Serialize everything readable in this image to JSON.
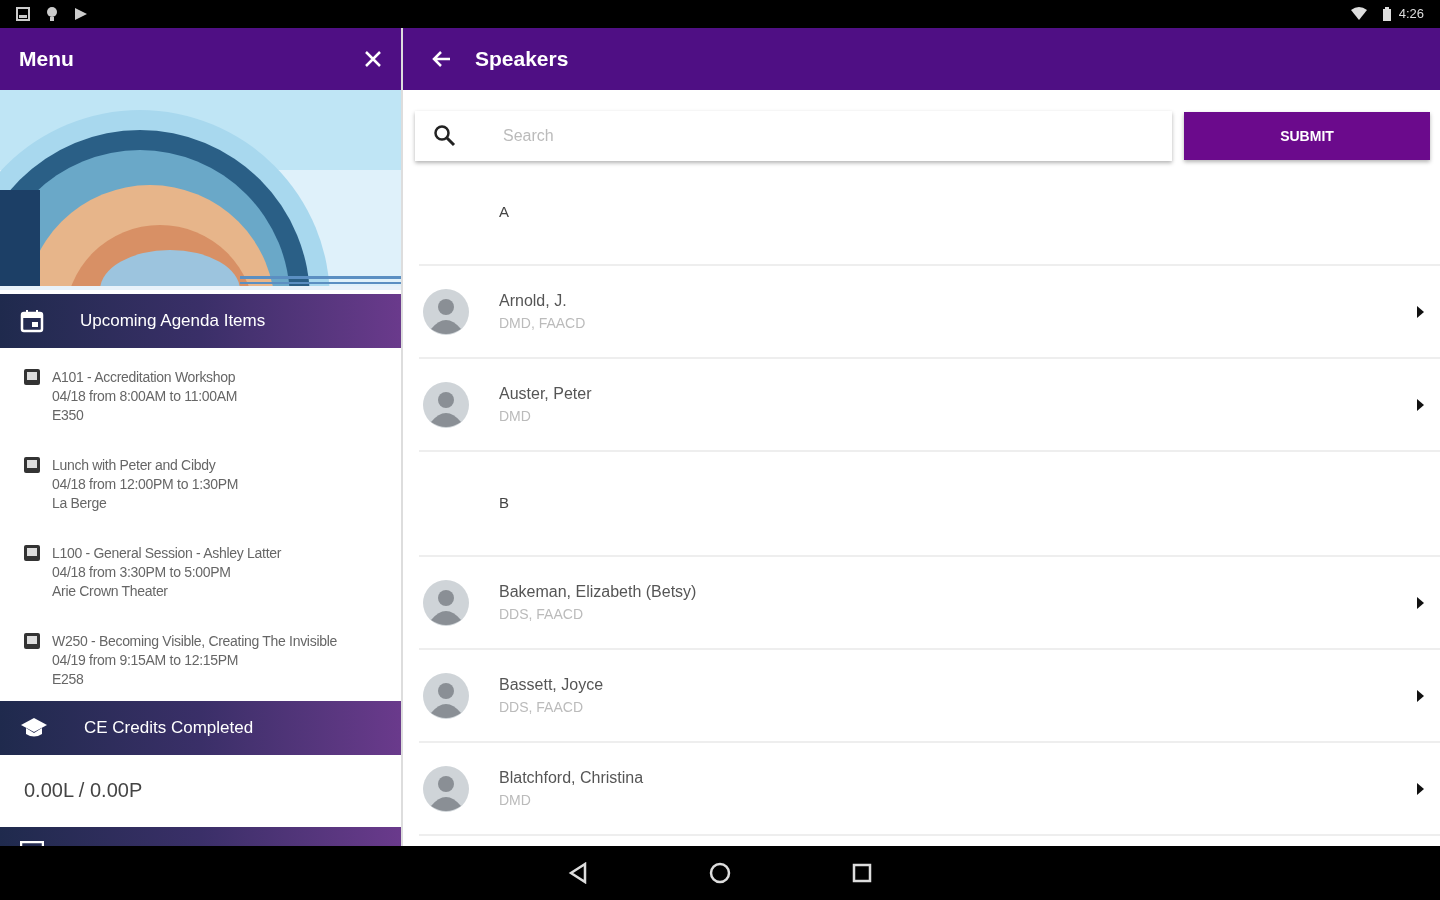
{
  "status_bar": {
    "time": "4:26"
  },
  "menu": {
    "title": "Menu",
    "sections": [
      {
        "kind": "agenda",
        "title": "Upcoming Agenda Items",
        "items": [
          {
            "title": "A101 - Accreditation Workshop",
            "time": "04/18 from 8:00AM to 11:00AM",
            "location": "E350"
          },
          {
            "title": "Lunch with Peter and Cibdy",
            "time": "04/18 from 12:00PM to 1:30PM",
            "location": "La Berge"
          },
          {
            "title": "L100 - General Session - Ashley Latter",
            "time": "04/18 from 3:30PM to 5:00PM",
            "location": "Arie Crown Theater"
          },
          {
            "title": "W250 - Becoming Visible, Creating The Invisible",
            "time": "04/19 from 9:15AM to 12:15PM",
            "location": "E258"
          }
        ]
      },
      {
        "kind": "credits",
        "title": "CE Credits Completed",
        "value": "0.00L / 0.00P"
      },
      {
        "kind": "cut"
      }
    ]
  },
  "page": {
    "title": "Speakers",
    "search": {
      "placeholder": "Search"
    },
    "submit": "SUBMIT",
    "groups": [
      {
        "letter": "A",
        "speakers": [
          {
            "name": "Arnold, J.",
            "credentials": "DMD, FAACD"
          },
          {
            "name": "Auster, Peter",
            "credentials": "DMD"
          }
        ]
      },
      {
        "letter": "B",
        "speakers": [
          {
            "name": "Bakeman, Elizabeth (Betsy)",
            "credentials": "DDS, FAACD"
          },
          {
            "name": "Bassett, Joyce",
            "credentials": "DDS, FAACD"
          },
          {
            "name": "Blatchford, Christina",
            "credentials": "DMD"
          }
        ]
      }
    ]
  }
}
